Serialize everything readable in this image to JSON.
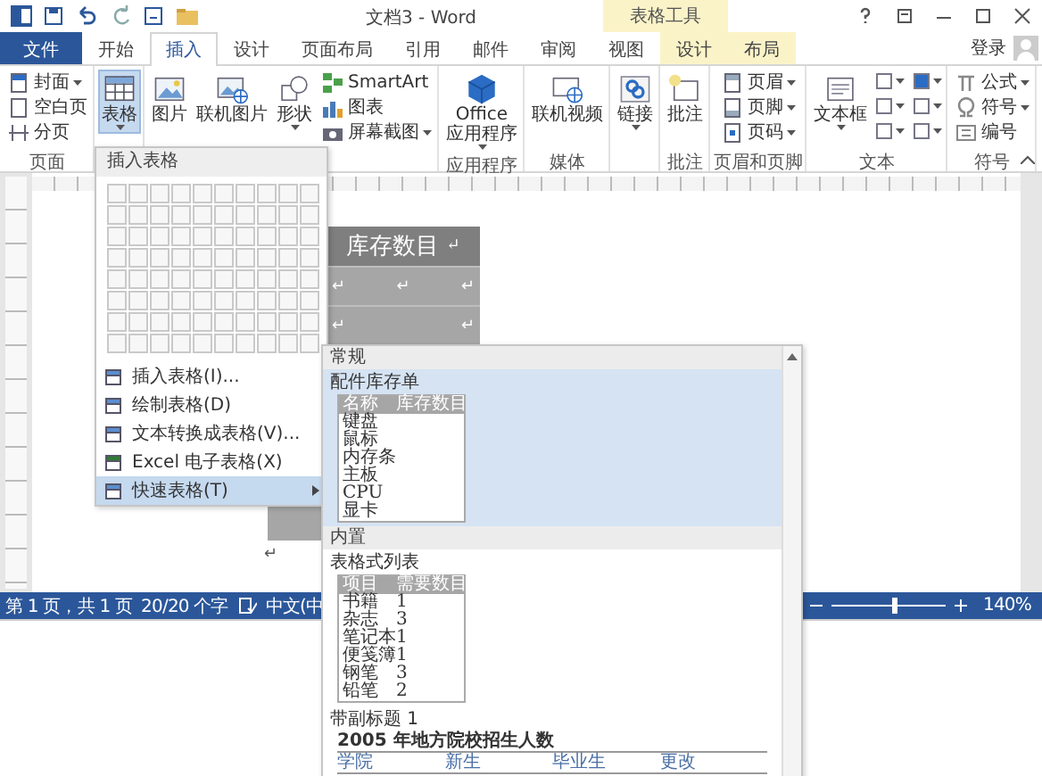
{
  "window": {
    "title": "文档3 - Word",
    "context_group": "表格工具"
  },
  "tabs": [
    {
      "label": "文件",
      "kind": "file",
      "selected": false
    },
    {
      "label": "开始",
      "kind": "normal",
      "selected": false
    },
    {
      "label": "插入",
      "kind": "normal",
      "selected": true
    },
    {
      "label": "设计",
      "kind": "normal",
      "selected": false
    },
    {
      "label": "页面布局",
      "kind": "normal",
      "selected": false
    },
    {
      "label": "引用",
      "kind": "normal",
      "selected": false
    },
    {
      "label": "邮件",
      "kind": "normal",
      "selected": false
    },
    {
      "label": "审阅",
      "kind": "normal",
      "selected": false
    },
    {
      "label": "视图",
      "kind": "normal",
      "selected": false
    },
    {
      "label": "设计",
      "kind": "context",
      "selected": false
    },
    {
      "label": "布局",
      "kind": "context",
      "selected": false
    }
  ],
  "account": {
    "label": "登录"
  },
  "ribbon_groups": [
    {
      "label": "页面",
      "commands": [
        {
          "label": "封面",
          "kind": "small",
          "dropdown": true,
          "pressed": false
        },
        {
          "label": "空白页",
          "kind": "small",
          "dropdown": false,
          "pressed": false
        },
        {
          "label": "分页",
          "kind": "small",
          "dropdown": false,
          "pressed": false
        }
      ]
    },
    {
      "commands": [
        {
          "label": "表格",
          "kind": "large",
          "dropdown": true,
          "pressed": true
        }
      ]
    },
    {
      "commands": [
        {
          "label": "图片",
          "kind": "large",
          "dropdown": false,
          "pressed": false
        },
        {
          "label": "联机图片",
          "kind": "large",
          "dropdown": false,
          "pressed": false
        },
        {
          "label": "形状",
          "kind": "large",
          "dropdown": true,
          "pressed": false
        },
        {
          "label": "SmartArt",
          "kind": "small",
          "dropdown": false,
          "pressed": false
        },
        {
          "label": "图表",
          "kind": "small",
          "dropdown": false,
          "pressed": false
        },
        {
          "label": "屏幕截图",
          "kind": "small",
          "dropdown": true,
          "pressed": false
        }
      ]
    },
    {
      "label": "应用程序",
      "commands": [
        {
          "label": "Office\n应用程序",
          "kind": "large",
          "dropdown": true,
          "pressed": false
        }
      ]
    },
    {
      "label": "媒体",
      "commands": [
        {
          "label": "联机视频",
          "kind": "large",
          "dropdown": false,
          "pressed": false
        }
      ]
    },
    {
      "commands": [
        {
          "label": "链接",
          "kind": "large",
          "dropdown": true,
          "pressed": false
        }
      ]
    },
    {
      "label": "批注",
      "commands": [
        {
          "label": "批注",
          "kind": "large",
          "dropdown": false,
          "pressed": false
        }
      ]
    },
    {
      "label": "页眉和页脚",
      "commands": [
        {
          "label": "页眉",
          "kind": "small",
          "dropdown": true,
          "pressed": false
        },
        {
          "label": "页脚",
          "kind": "small",
          "dropdown": true,
          "pressed": false
        },
        {
          "label": "页码",
          "kind": "small",
          "dropdown": true,
          "pressed": false
        }
      ]
    },
    {
      "label": "文本",
      "commands": [
        {
          "label": "文本框",
          "kind": "large",
          "dropdown": true,
          "pressed": false
        },
        {
          "kind": "tools",
          "dropdown": true,
          "pressed": false
        }
      ]
    },
    {
      "label": "符号",
      "commands": [
        {
          "label": "公式",
          "kind": "small",
          "dropdown": true,
          "pressed": false
        },
        {
          "label": "符号",
          "kind": "small",
          "dropdown": true,
          "pressed": false
        },
        {
          "label": "编号",
          "kind": "small",
          "dropdown": false,
          "pressed": false
        }
      ]
    }
  ],
  "document": {
    "table_header": "库存数目",
    "marks": [
      "↵",
      "↵",
      "↵",
      "↵",
      "↵",
      "↵",
      "↵"
    ]
  },
  "table_menu": {
    "header": "插入表格",
    "items": [
      {
        "label": "插入表格(I)...",
        "submenu": false,
        "selected": false
      },
      {
        "label": "绘制表格(D)",
        "submenu": false,
        "selected": false
      },
      {
        "label": "文本转换成表格(V)...",
        "submenu": false,
        "selected": false
      },
      {
        "label": "Excel 电子表格(X)",
        "submenu": false,
        "selected": false
      },
      {
        "label": "快速表格(T)",
        "submenu": true,
        "selected": true
      }
    ]
  },
  "quick_tables": {
    "sections": [
      {
        "heading": "常规",
        "items": [
          {
            "label": "配件库存单",
            "selected": true,
            "preview": {
              "header": [
                "名称",
                "库存数目"
              ],
              "rows": [
                [
                  "键盘",
                  ""
                ],
                [
                  "鼠标",
                  ""
                ],
                [
                  "内存条",
                  ""
                ],
                [
                  "主板",
                  ""
                ],
                [
                  "CPU",
                  ""
                ],
                [
                  "显卡",
                  ""
                ]
              ]
            }
          }
        ]
      },
      {
        "heading": "内置",
        "items": [
          {
            "label": "表格式列表",
            "selected": false,
            "preview": {
              "header": [
                "项目",
                "需要数目"
              ],
              "rows": [
                [
                  "书籍",
                  "1"
                ],
                [
                  "杂志",
                  "3"
                ],
                [
                  "笔记本",
                  "1"
                ],
                [
                  "便笺簿",
                  "1"
                ],
                [
                  "钢笔",
                  "3"
                ],
                [
                  "铅笔",
                  "2"
                ]
              ]
            }
          },
          {
            "label": "带副标题 1",
            "selected": false,
            "preview": {
              "caption": "2005 年地方院校招生人数",
              "header": [
                "学院",
                "新生",
                "毕业生",
                "更改"
              ]
            }
          }
        ]
      }
    ]
  },
  "status_bar": {
    "page": "第 1 页，共 1 页",
    "words": "20/20 个字",
    "language": "中文(中",
    "zoom": "140%",
    "zoom_slider": {
      "level": 0.55
    }
  }
}
